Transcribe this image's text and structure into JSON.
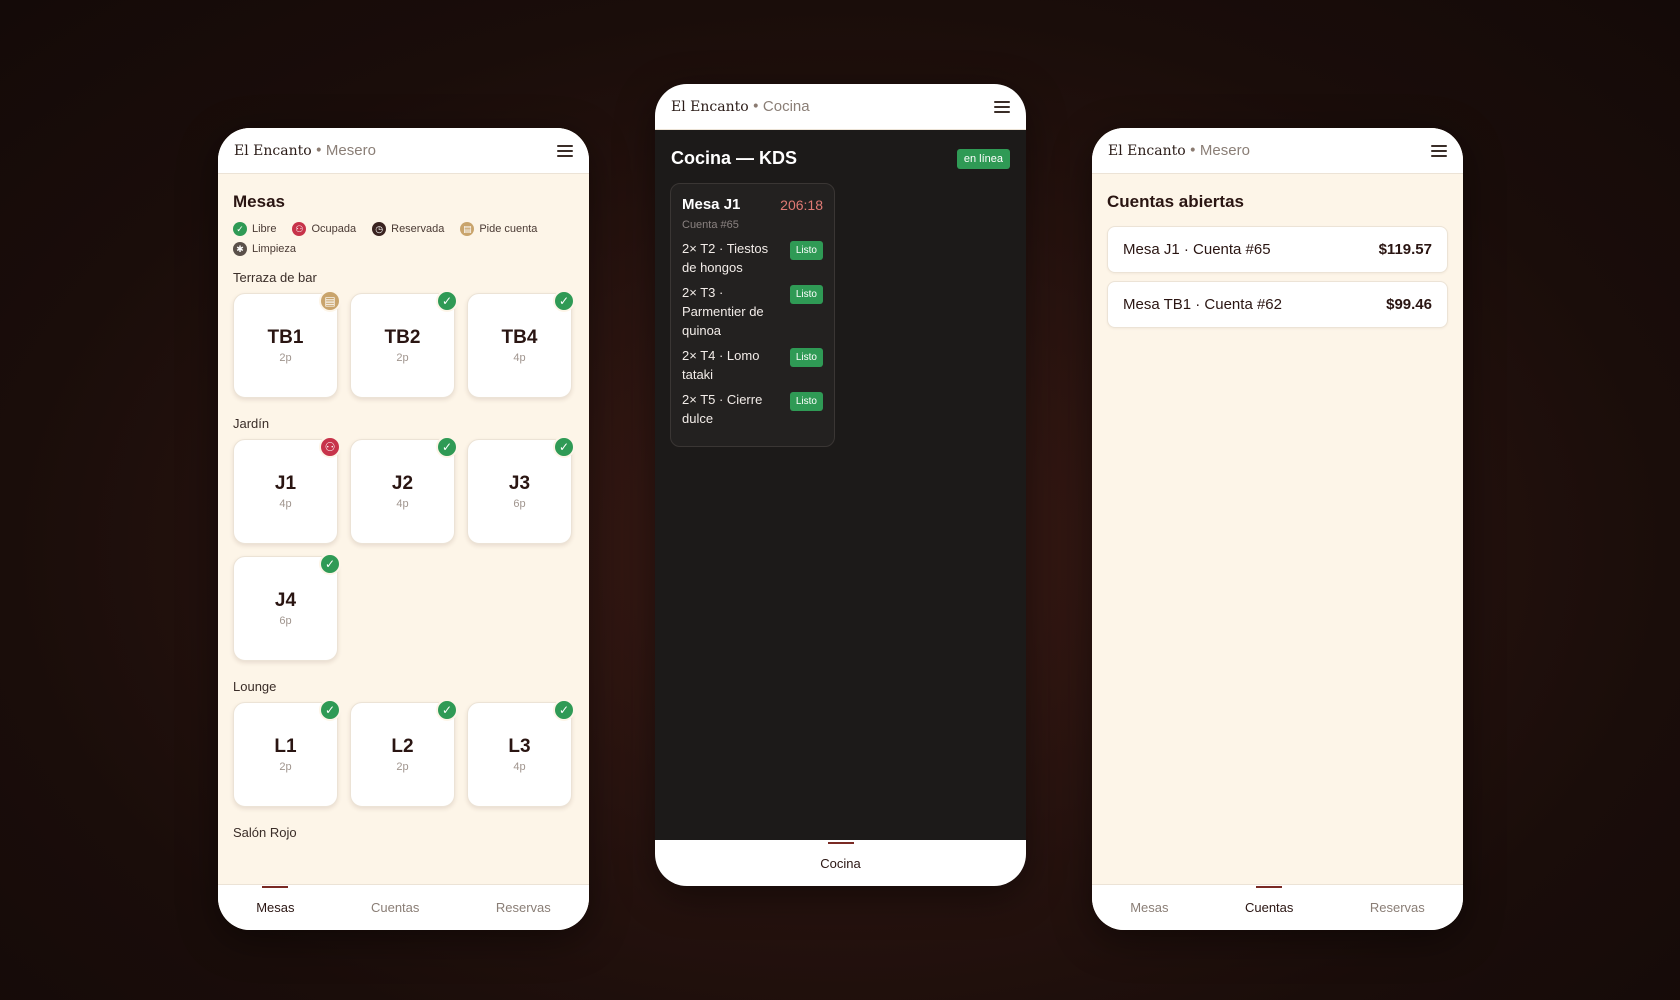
{
  "mesero": {
    "brand": "El Encanto",
    "separator": "•",
    "role": "Mesero",
    "title": "Mesas",
    "legend": [
      {
        "label": "Libre",
        "status": "libre",
        "icon": "check-icon"
      },
      {
        "label": "Ocupada",
        "status": "ocupada",
        "icon": "people-icon"
      },
      {
        "label": "Reservada",
        "status": "reservada",
        "icon": "clock-icon"
      },
      {
        "label": "Pide cuenta",
        "status": "pide",
        "icon": "receipt-icon"
      },
      {
        "label": "Limpieza",
        "status": "limpieza",
        "icon": "broom-icon"
      }
    ],
    "zones": [
      {
        "name": "Terraza de bar",
        "tables": [
          {
            "code": "TB1",
            "cap": "2p",
            "status": "pide"
          },
          {
            "code": "TB2",
            "cap": "2p",
            "status": "libre"
          },
          {
            "code": "TB4",
            "cap": "4p",
            "status": "libre"
          }
        ]
      },
      {
        "name": "Jardín",
        "tables": [
          {
            "code": "J1",
            "cap": "4p",
            "status": "ocupada"
          },
          {
            "code": "J2",
            "cap": "4p",
            "status": "libre"
          },
          {
            "code": "J3",
            "cap": "6p",
            "status": "libre"
          },
          {
            "code": "J4",
            "cap": "6p",
            "status": "libre"
          }
        ]
      },
      {
        "name": "Lounge",
        "tables": [
          {
            "code": "L1",
            "cap": "2p",
            "status": "libre"
          },
          {
            "code": "L2",
            "cap": "2p",
            "status": "libre"
          },
          {
            "code": "L3",
            "cap": "4p",
            "status": "libre"
          }
        ]
      },
      {
        "name": "Salón Rojo",
        "tables": []
      }
    ],
    "nav": [
      {
        "label": "Mesas",
        "active": true
      },
      {
        "label": "Cuentas",
        "active": false
      },
      {
        "label": "Reservas",
        "active": false
      }
    ]
  },
  "cocina": {
    "brand": "El Encanto",
    "separator": "•",
    "role": "Cocina",
    "title": "Cocina — KDS",
    "status": "en línea",
    "ticket": {
      "table": "Mesa J1",
      "timer": "206:18",
      "account": "Cuenta #65",
      "items": [
        {
          "text": "2× T2 · Tiestos de hongos",
          "action": "Listo"
        },
        {
          "text": "2× T3 · Parmentier de quinoa",
          "action": "Listo"
        },
        {
          "text": "2× T4 · Lomo tataki",
          "action": "Listo"
        },
        {
          "text": "2× T5 · Cierre dulce",
          "action": "Listo"
        }
      ]
    },
    "nav": [
      {
        "label": "Cocina",
        "active": true
      }
    ]
  },
  "cuentas": {
    "brand": "El Encanto",
    "separator": "•",
    "role": "Mesero",
    "title": "Cuentas abiertas",
    "accounts": [
      {
        "name": "Mesa J1 · Cuenta #65",
        "total": "$119.57"
      },
      {
        "name": "Mesa TB1 · Cuenta #62",
        "total": "$99.46"
      }
    ],
    "nav": [
      {
        "label": "Mesas",
        "active": false
      },
      {
        "label": "Cuentas",
        "active": true
      },
      {
        "label": "Reservas",
        "active": false
      }
    ]
  },
  "colors": {
    "libre": "#2f9a55",
    "ocupada": "#c7334a",
    "reservada": "#3a2320",
    "pide": "#c9a46c",
    "limpieza": "#5a504a",
    "accent": "#7a2a24"
  }
}
